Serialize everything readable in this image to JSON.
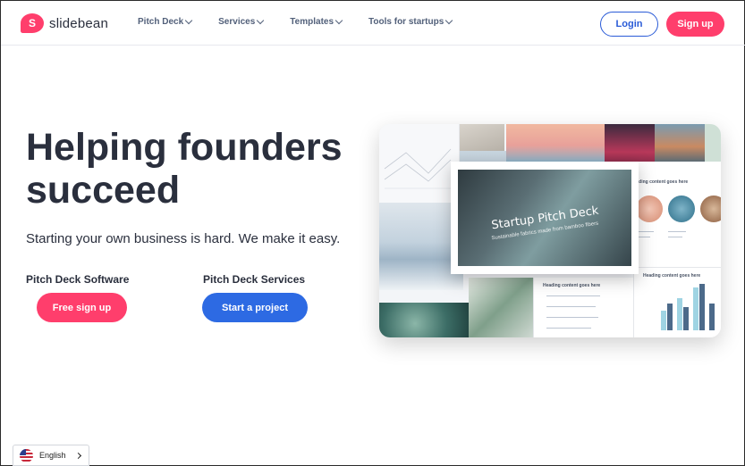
{
  "brand": {
    "name": "slidebean",
    "mark": "S",
    "color": "#ff3e6c"
  },
  "nav": {
    "items": [
      {
        "label": "Pitch Deck"
      },
      {
        "label": "Services"
      },
      {
        "label": "Templates"
      },
      {
        "label": "Tools for startups"
      }
    ],
    "login_label": "Login",
    "signup_label": "Sign up"
  },
  "hero": {
    "title": "Helping founders succeed",
    "subtitle": "Starting your own business is hard. We make it easy.",
    "software": {
      "label": "Pitch Deck Software",
      "button": "Free sign up"
    },
    "services": {
      "label": "Pitch Deck Services",
      "button": "Start a project"
    }
  },
  "collage": {
    "feature_title": "Startup Pitch Deck",
    "feature_subtitle": "Sustainable fabrics made from bamboo fibers",
    "heading_text": "Heading content goes here"
  },
  "language": {
    "label": "English",
    "flag_icon": "us-flag-icon"
  },
  "colors": {
    "accent_pink": "#ff3e6c",
    "accent_blue": "#2d6ae3",
    "login_blue": "#2a5bd7"
  }
}
